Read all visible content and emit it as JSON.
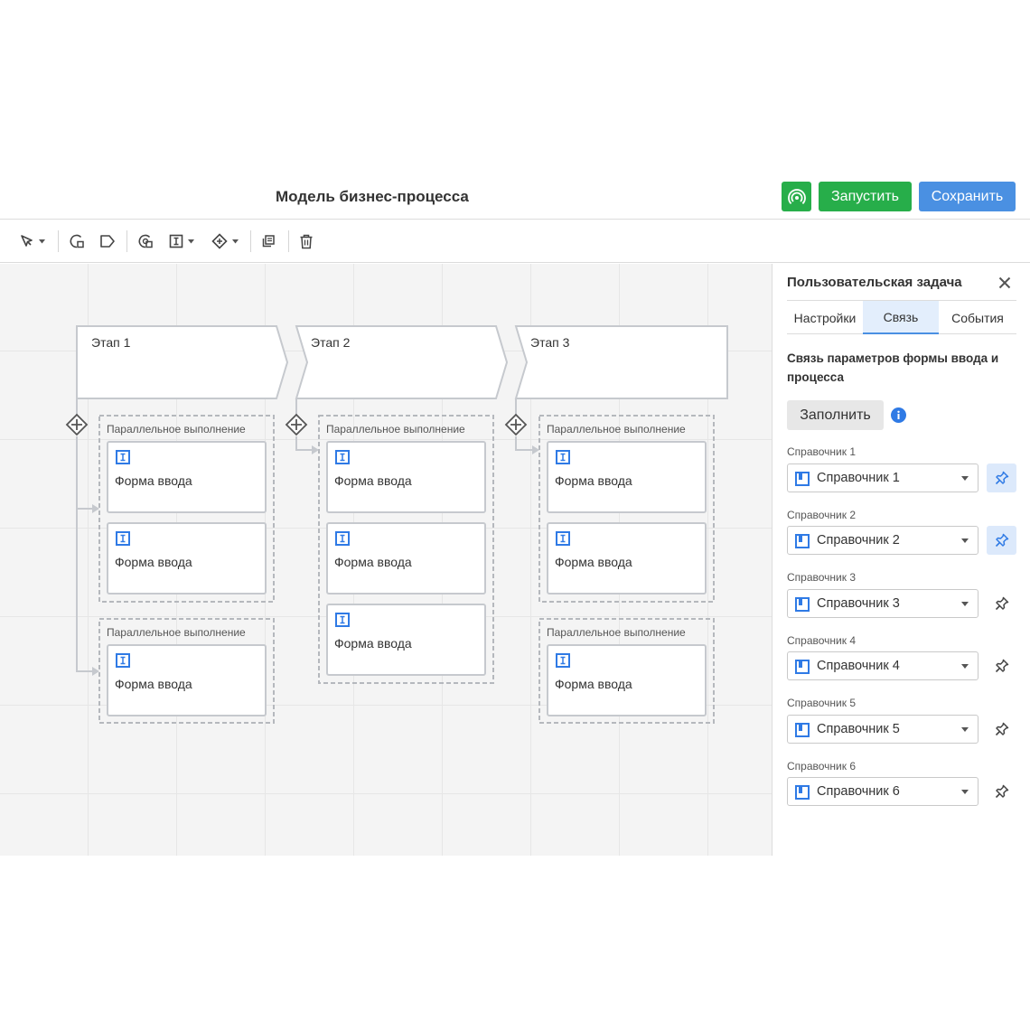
{
  "header": {
    "title": "Модель бизнес-процесса",
    "run_label": "Запустить",
    "save_label": "Сохранить"
  },
  "toolbar": {
    "tools": [
      "pointer-tool-icon",
      "user-task-icon",
      "label-tool-icon",
      "sub-process-icon",
      "form-tool-icon",
      "gateway-tool-icon",
      "copy-icon",
      "delete-icon"
    ]
  },
  "diagram": {
    "stages": [
      {
        "label": "Этап 1",
        "groups": [
          {
            "label": "Параллельное выполнение",
            "forms": [
              "Форма ввода",
              "Форма ввода"
            ]
          },
          {
            "label": "Параллельное выполнение",
            "forms": [
              "Форма ввода"
            ]
          }
        ]
      },
      {
        "label": "Этап 2",
        "groups": [
          {
            "label": "Параллельное выполнение",
            "forms": [
              "Форма ввода",
              "Форма ввода",
              "Форма ввода"
            ]
          }
        ]
      },
      {
        "label": "Этап 3",
        "groups": [
          {
            "label": "Параллельное выполнение",
            "forms": [
              "Форма ввода",
              "Форма ввода"
            ]
          },
          {
            "label": "Параллельное выполнение",
            "forms": [
              "Форма ввода"
            ]
          }
        ]
      }
    ]
  },
  "panel": {
    "title": "Пользовательская задача",
    "tabs": [
      "Настройки",
      "Связь",
      "События"
    ],
    "active_tab": "Связь",
    "section_title": "Связь параметров формы ввода и процесса",
    "fill_label": "Заполнить",
    "references": [
      {
        "label": "Справочник 1",
        "value": "Справочник 1",
        "pinned": true
      },
      {
        "label": "Справочник 2",
        "value": "Справочник 2",
        "pinned": true
      },
      {
        "label": "Справочник 3",
        "value": "Справочник 3",
        "pinned": false
      },
      {
        "label": "Справочник 4",
        "value": "Справочник 4",
        "pinned": false
      },
      {
        "label": "Справочник 5",
        "value": "Справочник 5",
        "pinned": false
      },
      {
        "label": "Справочник 6",
        "value": "Справочник 6",
        "pinned": false
      }
    ]
  },
  "colors": {
    "run_green": "#27ae4a",
    "save_blue": "#4a90e2",
    "accent_blue": "#2f7ae5",
    "active_tab_bg": "#e3eefc"
  }
}
